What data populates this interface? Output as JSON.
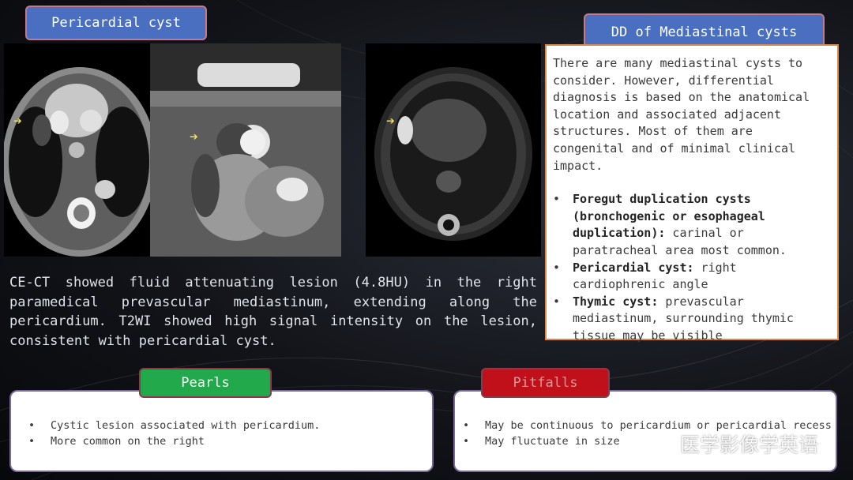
{
  "case_title": "Pericardial cyst",
  "dd_title": "DD of Mediastinal cysts",
  "description": "CE-CT showed fluid attenuating lesion (4.8HU) in the right paramedical prevascular mediastinum, extending along the pericardium. T2WI showed high signal intensity on the lesion, consistent with pericardial cyst.",
  "dd": {
    "intro": "There are many mediastinal cysts to consider. However, differential diagnosis is based on the anatomical location and associated adjacent structures. Most of them are congenital and of minimal clinical impact.",
    "items": [
      {
        "bold": "Foregut duplication cysts (bronchogenic or esophageal duplication):",
        "text": " carinal or paratracheal area most common."
      },
      {
        "bold": "Pericardial cyst:",
        "text": " right cardiophrenic angle"
      },
      {
        "bold": "Thymic cyst:",
        "text": " prevascular mediastinum, surrounding thymic tissue may be visible"
      }
    ]
  },
  "pearls": {
    "title": "Pearls",
    "items": [
      "Cystic lesion associated with pericardium.",
      "More common on the right"
    ]
  },
  "pitfalls": {
    "title": "Pitfalls",
    "items": [
      "May be continuous to pericardium or pericardial recess",
      "May fluctuate in size"
    ]
  },
  "watermark": "医学影像学英语",
  "arrow_glyph": "➔",
  "bullet_glyph": "•",
  "colors": {
    "title_blue": "#4a6fc0",
    "pearls_green": "#22a94b",
    "pitfalls_red": "#c0101a",
    "arrow_yellow": "#f4e44a",
    "dd_border": "#d88a50"
  },
  "images": [
    {
      "name": "ct-axial",
      "icon": "ct-scan-image"
    },
    {
      "name": "ct-coronal",
      "icon": "ct-scan-image"
    },
    {
      "name": "t2-axial",
      "icon": "mri-scan-image"
    }
  ]
}
